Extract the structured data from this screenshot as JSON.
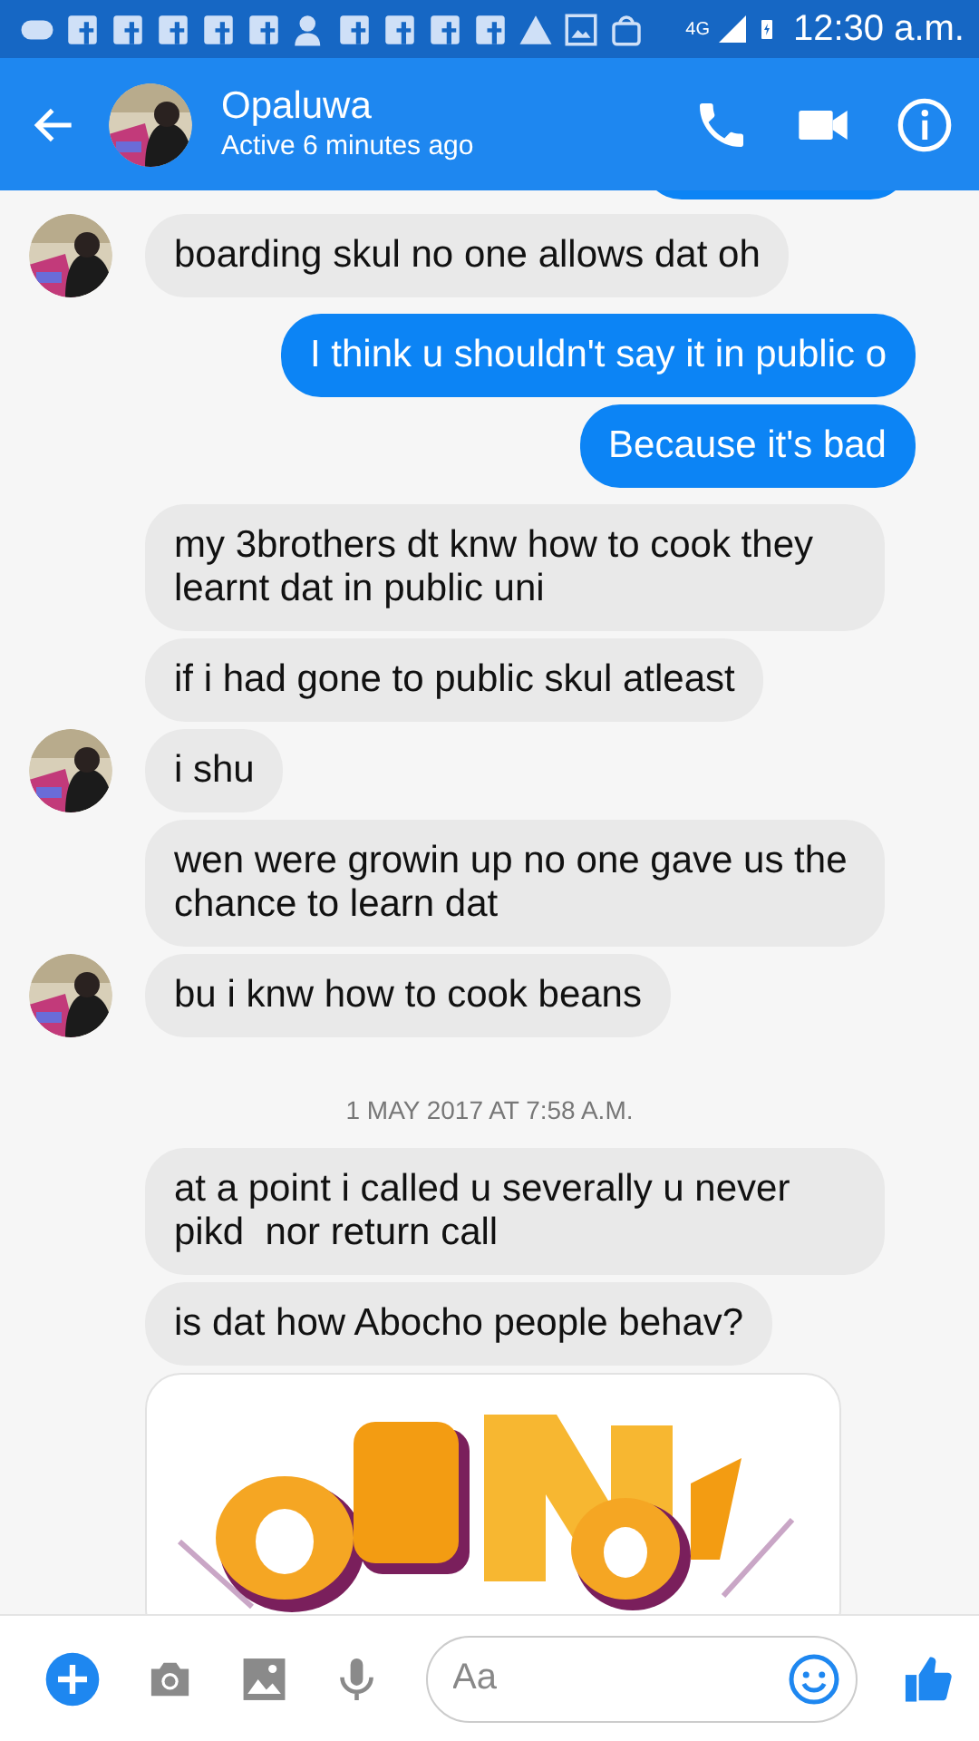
{
  "status_bar": {
    "network": "4G",
    "time": "12:30 a.m."
  },
  "header": {
    "name": "Opaluwa",
    "status": "Active 6 minutes ago"
  },
  "messages": [
    {
      "kind": "cutoff",
      "outgoing": true
    },
    {
      "kind": "text",
      "outgoing": false,
      "avatar": true,
      "text": "boarding skul no one allows dat oh"
    },
    {
      "kind": "text",
      "outgoing": true,
      "text": "I think u shouldn't say it in public o"
    },
    {
      "kind": "text",
      "outgoing": true,
      "text": "Because it's bad"
    },
    {
      "kind": "text",
      "outgoing": false,
      "avatar": false,
      "text": "my 3brothers dt knw how to cook they learnt dat in public uni"
    },
    {
      "kind": "text",
      "outgoing": false,
      "avatar": false,
      "text": "if i had gone to public skul atleast"
    },
    {
      "kind": "text",
      "outgoing": false,
      "avatar": true,
      "text": "i shu"
    },
    {
      "kind": "text",
      "outgoing": false,
      "avatar": false,
      "text": "wen were growin up no one gave us the chance to learn dat"
    },
    {
      "kind": "text",
      "outgoing": false,
      "avatar": true,
      "text": "bu i knw how to cook beans"
    },
    {
      "kind": "timestamp",
      "text": "1 MAY 2017 AT 7:58 A.M."
    },
    {
      "kind": "text",
      "outgoing": false,
      "avatar": false,
      "text": "at a point i called u severally u never pikd  nor return call"
    },
    {
      "kind": "text",
      "outgoing": false,
      "avatar": false,
      "text": "is dat how Abocho people behav?"
    },
    {
      "kind": "sticker",
      "outgoing": false,
      "avatar": false
    }
  ],
  "composer": {
    "placeholder": "Aa"
  }
}
